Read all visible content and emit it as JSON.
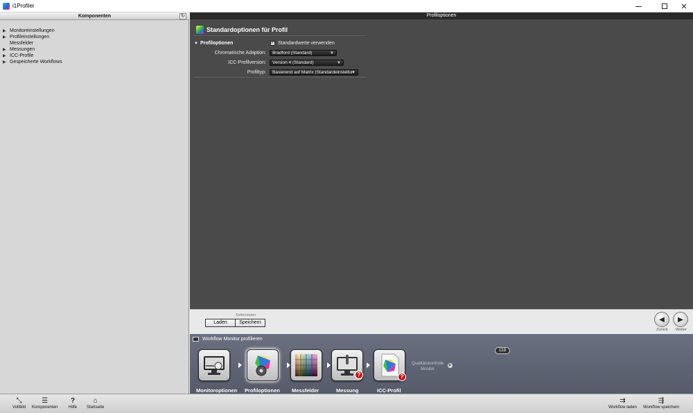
{
  "window": {
    "title": "i1Profiler"
  },
  "left_panel": {
    "header": "Komponenten",
    "items": [
      {
        "label": "Monitoreinstellungen",
        "expandable": true
      },
      {
        "label": "Profileinstellungen",
        "expandable": true
      },
      {
        "label": "Messfelder",
        "expandable": false
      },
      {
        "label": "Messungen",
        "expandable": true
      },
      {
        "label": "ICC-Profile",
        "expandable": true
      },
      {
        "label": "Gespeicherte Workflows",
        "expandable": true
      }
    ]
  },
  "main": {
    "header": "Profiloptionen",
    "section_title": "Standardoptionen für Profil",
    "group_label": "Profiloptionen",
    "use_defaults_label": "Standardwerte verwenden",
    "use_defaults_checked": true,
    "fields": {
      "adaptation": {
        "label": "Chromatische Adaption:",
        "value": "Bradford (Standard)"
      },
      "icc_version": {
        "label": "ICC-Profilversion:",
        "value": "Version 4 (Standard)"
      },
      "profile_type": {
        "label": "Profiltyp:",
        "value": "Basierend auf Matrix (Standardeinstellur"
      }
    }
  },
  "page_data": {
    "caption": "Seitendaten",
    "load_label": "Laden",
    "save_label": "Speichern"
  },
  "nav": {
    "back_label": "Zurück",
    "forward_label": "Weiter"
  },
  "workflow": {
    "title": "Workflow Monitor profilieren",
    "steps": [
      {
        "label": "Monitoroptionen"
      },
      {
        "label": "Profiloptionen"
      },
      {
        "label": "Messfelder",
        "badge": "118"
      },
      {
        "label": "Messung"
      },
      {
        "label": "ICC-Profil"
      }
    ],
    "next_line1": "Qualitätskontrolle",
    "next_line2": "Monitor"
  },
  "toolbar": {
    "fullscreen": "Vollbild",
    "components": "Komponenten",
    "help": "Hilfe",
    "home": "Startseite",
    "load_workflow": "Workflow laden",
    "save_workflow": "Workflow speichern"
  }
}
